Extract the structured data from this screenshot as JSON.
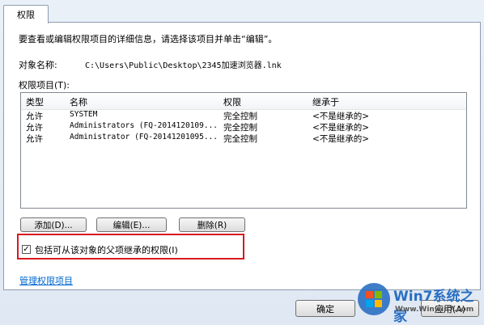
{
  "tab": {
    "label": "权限"
  },
  "instruction": "要查看或编辑权限项目的详细信息，请选择该项目并单击“编辑”。",
  "object": {
    "label": "对象名称:",
    "path": "C:\\Users\\Public\\Desktop\\2345加速浏览器.lnk"
  },
  "permissions": {
    "label": "权限项目(T):",
    "columns": [
      "类型",
      "名称",
      "权限",
      "继承于"
    ],
    "rows": [
      {
        "type": "允许",
        "name": "SYSTEM",
        "permission": "完全控制",
        "inherited": "<不是继承的>"
      },
      {
        "type": "允许",
        "name": "Administrators (FQ-2014120109...",
        "permission": "完全控制",
        "inherited": "<不是继承的>"
      },
      {
        "type": "允许",
        "name": "Administrator (FQ-20141201095...",
        "permission": "完全控制",
        "inherited": "<不是继承的>"
      }
    ]
  },
  "buttons": {
    "add": "添加(D)...",
    "edit": "编辑(E)...",
    "remove": "删除(R)"
  },
  "inherit_checkbox": {
    "label": "包括可从该对象的父项继承的权限(I)",
    "checked": true
  },
  "manage_link": "管理权限项目",
  "footer": {
    "ok": "确定",
    "apply": "应用(A)"
  },
  "watermark": {
    "brand": "Win7系统之家",
    "url": "Www.Winwin7.com"
  }
}
